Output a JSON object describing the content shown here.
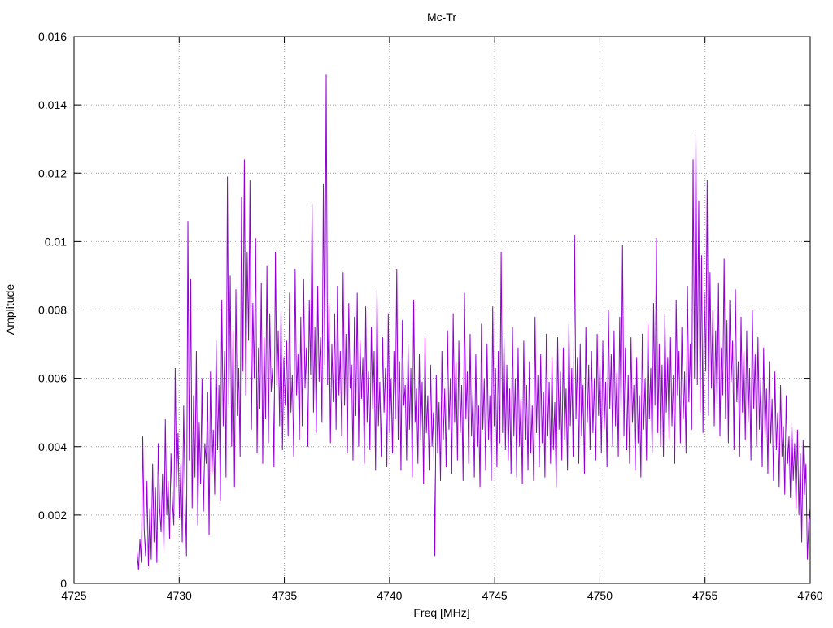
{
  "chart_data": {
    "type": "line",
    "title": "Mc-Tr",
    "xlabel": "Freq [MHz]",
    "ylabel": "Amplitude",
    "xlim": [
      4725,
      4760
    ],
    "ylim": [
      0,
      0.016
    ],
    "x_ticks": [
      4725,
      4730,
      4735,
      4740,
      4745,
      4750,
      4755,
      4760
    ],
    "x_tick_labels": [
      "4725",
      "4730",
      "4735",
      "4740",
      "4745",
      "4750",
      "4755",
      "4760"
    ],
    "y_ticks": [
      0,
      0.002,
      0.004,
      0.006,
      0.008,
      0.01,
      0.012,
      0.014,
      0.016
    ],
    "y_tick_labels": [
      "0",
      "0.002",
      "0.004",
      "0.006",
      "0.008",
      "0.01",
      "0.012",
      "0.014",
      "0.016"
    ],
    "grid": true,
    "series": [
      {
        "color": "#9400d3",
        "x_start": 4728.0,
        "x_end": 4760.0,
        "x_step": 0.05,
        "y": [
          0.0009,
          0.0004,
          0.0013,
          0.0006,
          0.0043,
          0.0016,
          0.0008,
          0.003,
          0.0005,
          0.0022,
          0.0007,
          0.0035,
          0.0012,
          0.0028,
          0.0006,
          0.0041,
          0.0022,
          0.0015,
          0.0032,
          0.0009,
          0.0048,
          0.002,
          0.003,
          0.0013,
          0.0038,
          0.0024,
          0.0017,
          0.0063,
          0.0028,
          0.0044,
          0.0019,
          0.0035,
          0.0012,
          0.0052,
          0.0026,
          0.0008,
          0.0106,
          0.0036,
          0.0089,
          0.0022,
          0.0055,
          0.0031,
          0.0068,
          0.0017,
          0.0047,
          0.0029,
          0.006,
          0.0021,
          0.0041,
          0.0035,
          0.0056,
          0.0014,
          0.0062,
          0.0032,
          0.0045,
          0.0026,
          0.0071,
          0.0039,
          0.0058,
          0.0024,
          0.0083,
          0.0046,
          0.0068,
          0.0031,
          0.0119,
          0.0052,
          0.009,
          0.004,
          0.0074,
          0.0028,
          0.0086,
          0.0049,
          0.0063,
          0.0037,
          0.0113,
          0.0062,
          0.0124,
          0.0055,
          0.0097,
          0.0071,
          0.0118,
          0.0045,
          0.0082,
          0.006,
          0.0101,
          0.0038,
          0.0069,
          0.0051,
          0.0088,
          0.0035,
          0.0072,
          0.0048,
          0.0093,
          0.0041,
          0.0079,
          0.0056,
          0.0063,
          0.0034,
          0.0097,
          0.0058,
          0.0074,
          0.0046,
          0.0081,
          0.0039,
          0.0066,
          0.0052,
          0.0071,
          0.0043,
          0.0085,
          0.005,
          0.0061,
          0.0037,
          0.0092,
          0.0055,
          0.0067,
          0.0042,
          0.0078,
          0.0046,
          0.0089,
          0.0057,
          0.0069,
          0.004,
          0.0083,
          0.0061,
          0.0111,
          0.005,
          0.0075,
          0.0044,
          0.0087,
          0.0059,
          0.0072,
          0.0047,
          0.0117,
          0.0064,
          0.0149,
          0.0058,
          0.0082,
          0.0041,
          0.007,
          0.0053,
          0.0079,
          0.0045,
          0.0087,
          0.0055,
          0.0068,
          0.0043,
          0.0091,
          0.0052,
          0.0073,
          0.0038,
          0.0082,
          0.0057,
          0.0064,
          0.0036,
          0.0078,
          0.0049,
          0.0085,
          0.004,
          0.0071,
          0.0054,
          0.0066,
          0.0035,
          0.0081,
          0.0047,
          0.0062,
          0.0039,
          0.0075,
          0.0051,
          0.0068,
          0.0033,
          0.0086,
          0.0046,
          0.0059,
          0.0037,
          0.0072,
          0.005,
          0.0063,
          0.0034,
          0.0079,
          0.0044,
          0.006,
          0.0038,
          0.0068,
          0.0048,
          0.0092,
          0.0042,
          0.0065,
          0.0033,
          0.0077,
          0.0052,
          0.0058,
          0.0036,
          0.007,
          0.0045,
          0.0063,
          0.0031,
          0.0083,
          0.0047,
          0.0057,
          0.0035,
          0.0067,
          0.0042,
          0.0059,
          0.0029,
          0.0072,
          0.0044,
          0.0055,
          0.0033,
          0.0064,
          0.004,
          0.005,
          0.0008,
          0.0061,
          0.0038,
          0.0053,
          0.003,
          0.0068,
          0.0042,
          0.0057,
          0.0034,
          0.0074,
          0.0045,
          0.006,
          0.0032,
          0.0079,
          0.0047,
          0.0065,
          0.0036,
          0.0071,
          0.0044,
          0.0058,
          0.003,
          0.0085,
          0.0048,
          0.0062,
          0.0035,
          0.0073,
          0.0043,
          0.0056,
          0.0031,
          0.0067,
          0.004,
          0.0052,
          0.0028,
          0.0076,
          0.0045,
          0.006,
          0.0033,
          0.007,
          0.0042,
          0.0055,
          0.003,
          0.0081,
          0.0046,
          0.0063,
          0.0034,
          0.0068,
          0.0041,
          0.0097,
          0.0044,
          0.0072,
          0.0039,
          0.0064,
          0.0036,
          0.0057,
          0.0032,
          0.0075,
          0.0043,
          0.006,
          0.0031,
          0.0069,
          0.004,
          0.0054,
          0.0029,
          0.0071,
          0.0042,
          0.0058,
          0.0033,
          0.0065,
          0.0038,
          0.0052,
          0.003,
          0.0078,
          0.0044,
          0.0061,
          0.0034,
          0.0067,
          0.0041,
          0.0056,
          0.0031,
          0.0073,
          0.0043,
          0.0059,
          0.0035,
          0.0066,
          0.0039,
          0.0053,
          0.0028,
          0.0072,
          0.0045,
          0.0062,
          0.0036,
          0.0069,
          0.0042,
          0.0057,
          0.0033,
          0.0076,
          0.0046,
          0.0063,
          0.0037,
          0.0102,
          0.0048,
          0.0066,
          0.0035,
          0.007,
          0.0043,
          0.0058,
          0.0032,
          0.0075,
          0.0047,
          0.0064,
          0.0039,
          0.0068,
          0.0044,
          0.006,
          0.0036,
          0.0073,
          0.0049,
          0.0065,
          0.0038,
          0.0071,
          0.0045,
          0.0059,
          0.0034,
          0.008,
          0.0051,
          0.0067,
          0.004,
          0.0074,
          0.0046,
          0.0062,
          0.0037,
          0.0078,
          0.005,
          0.0099,
          0.0043,
          0.0069,
          0.0039,
          0.0061,
          0.0035,
          0.0072,
          0.0047,
          0.0058,
          0.0033,
          0.0066,
          0.0041,
          0.0055,
          0.0031,
          0.0073,
          0.0045,
          0.006,
          0.0036,
          0.0076,
          0.0048,
          0.0063,
          0.0038,
          0.0082,
          0.0052,
          0.0101,
          0.0044,
          0.007,
          0.004,
          0.0064,
          0.0037,
          0.0079,
          0.005,
          0.0066,
          0.0042,
          0.0072,
          0.0046,
          0.0061,
          0.0035,
          0.0083,
          0.0055,
          0.0068,
          0.0041,
          0.0075,
          0.0048,
          0.0062,
          0.0038,
          0.0087,
          0.0053,
          0.007,
          0.0045,
          0.0124,
          0.006,
          0.0132,
          0.0058,
          0.0112,
          0.005,
          0.0096,
          0.0044,
          0.0085,
          0.0062,
          0.0118,
          0.0049,
          0.0091,
          0.0057,
          0.008,
          0.0046,
          0.0074,
          0.0052,
          0.0088,
          0.0043,
          0.0069,
          0.0055,
          0.0095,
          0.0048,
          0.0077,
          0.0041,
          0.0083,
          0.0059,
          0.0071,
          0.0039,
          0.0086,
          0.0053,
          0.0065,
          0.0037,
          0.0078,
          0.005,
          0.0068,
          0.0042,
          0.0074,
          0.0047,
          0.0063,
          0.0036,
          0.008,
          0.0051,
          0.0067,
          0.004,
          0.0072,
          0.0045,
          0.006,
          0.0034,
          0.0069,
          0.0043,
          0.0057,
          0.0032,
          0.0065,
          0.0041,
          0.0054,
          0.003,
          0.0062,
          0.0039,
          0.005,
          0.0028,
          0.0058,
          0.0037,
          0.0046,
          0.0026,
          0.0055,
          0.0035,
          0.0043,
          0.0025,
          0.0047,
          0.003,
          0.0041,
          0.0022,
          0.0045,
          0.002,
          0.0038,
          0.0012,
          0.0042,
          0.0026,
          0.0035,
          0.0007,
          0.0018,
          0.0022
        ]
      }
    ]
  }
}
